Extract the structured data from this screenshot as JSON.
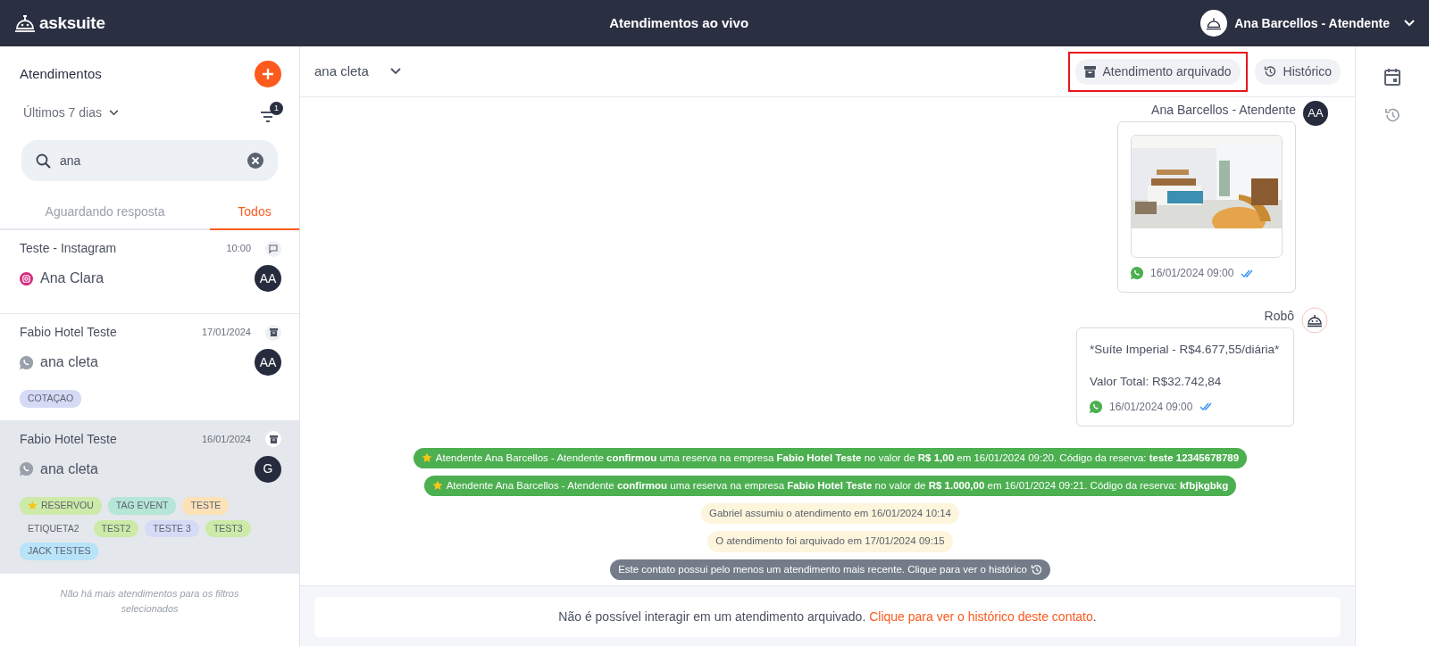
{
  "topbar": {
    "logo": "asksuite",
    "title": "Atendimentos ao vivo",
    "user": "Ana Barcellos - Atendente"
  },
  "sidebar": {
    "title": "Atendimentos",
    "period": "Últimos 7 dias",
    "filter_count": "1",
    "search": {
      "value": "ana"
    },
    "tabs": [
      {
        "label": "Aguardando resposta",
        "selected": false
      },
      {
        "label": "Todos",
        "selected": true
      }
    ],
    "conversations": [
      {
        "title": "Teste - Instagram",
        "time": "10:00",
        "archived": false,
        "kind": "instagram",
        "contact": "Ana Clara",
        "agent": "AA",
        "selected": false
      },
      {
        "title": "Fabio Hotel Teste",
        "time": "17/01/2024",
        "archived": true,
        "kind": "whatsapp",
        "contact": "ana cleta",
        "agent": "AA",
        "selected": false,
        "tags": [
          {
            "label": "COTAÇAO",
            "color": "#d5dbf5",
            "starred": false
          }
        ]
      },
      {
        "title": "Fabio Hotel Teste",
        "time": "16/01/2024",
        "archived": true,
        "kind": "whatsapp",
        "contact": "ana cleta",
        "agent": "G",
        "selected": true,
        "tags": [
          {
            "label": "RESERVOU",
            "color": "#cdeaa8",
            "starred": true
          },
          {
            "label": "TAG EVENT",
            "color": "#b5e6d6",
            "starred": false
          },
          {
            "label": "TESTE",
            "color": "#fde1b7",
            "starred": false
          },
          {
            "label": "ETIQUETA2",
            "starred": false
          },
          {
            "label": "TEST2",
            "color": "#cdeaa8",
            "starred": false
          },
          {
            "label": "TESTE 3",
            "color": "#d5dbf5",
            "starred": false
          },
          {
            "label": "TEST3",
            "color": "#cdeaa8",
            "starred": false
          },
          {
            "label": "JACK TESTES",
            "color": "#b8e3f8",
            "starred": false
          }
        ]
      }
    ],
    "end_note": "Não há mais atendimentos para os filtros selecionados"
  },
  "chat": {
    "contact": "ana cleta",
    "actions": [
      {
        "label": "Atendimento arquivado",
        "kind": "archive",
        "highlighted": true
      },
      {
        "label": "Histórico",
        "kind": "history",
        "highlighted": false
      }
    ],
    "messages": [
      {
        "sender": "Ana Barcellos - Atendente",
        "avatar": "AA",
        "time": "16/01/2024 09:00",
        "read": true
      },
      {
        "kind": "text",
        "sender": "Robô",
        "lines": [
          "*Suíte Imperial - R$4.677,55/diária*",
          "Valor Total: R$32.742,84"
        ],
        "time": "16/01/2024 09:00",
        "read": true
      }
    ],
    "events": [
      {
        "kind": "reservation",
        "text": "Atendente Ana Barcellos - Atendente **confirmou** uma reserva na empresa **Fabio Hotel Teste** no valor de **R$ 1,00** em 16/01/2024 09:20. Código da reserva: **teste 12345678789**"
      },
      {
        "kind": "reservation",
        "text": "Atendente Ana Barcellos - Atendente **confirmou** uma reserva na empresa **Fabio Hotel Teste** no valor de **R$ 1.000,00** em 16/01/2024 09:21. Código da reserva: **kfbjkgbkg**"
      },
      {
        "kind": "system",
        "text": "Gabriel assumiu o atendimento em 16/01/2024 10:14"
      },
      {
        "kind": "system",
        "text": "O atendimento foi arquivado em 17/01/2024 09:15"
      },
      {
        "kind": "notice",
        "text": "Este contato possui pelo menos um atendimento mais recente. Clique para ver o histórico"
      }
    ],
    "footer": {
      "text": "Não é possível interagir em um atendimento arquivado.",
      "link": "Clique para ver o histórico deste contato",
      "suffix": "."
    }
  }
}
